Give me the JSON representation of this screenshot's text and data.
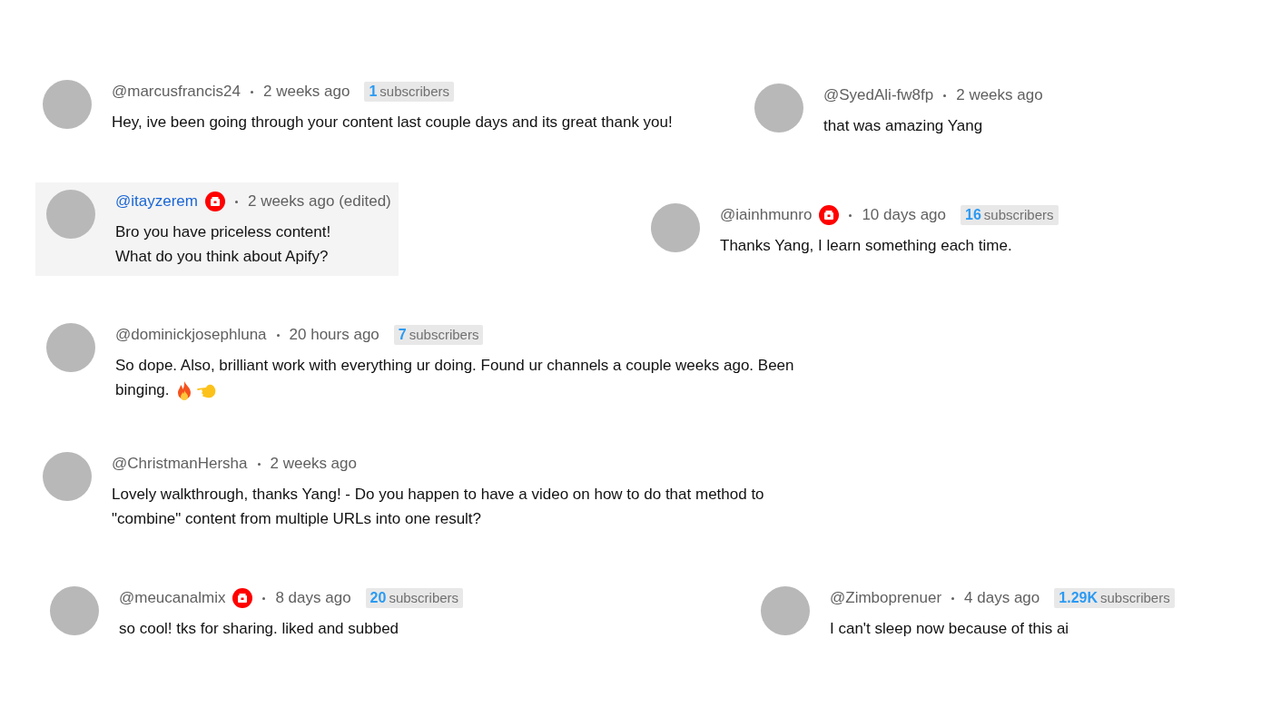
{
  "rows": [
    {
      "comments": [
        {
          "author": "@marcusfrancis24",
          "time": "2 weeks ago",
          "subscribers": {
            "count": "1",
            "label": "subscribers"
          },
          "highlighted": false,
          "lines": [
            "Hey, ive been going through your content last couple days and its great thank you!"
          ]
        },
        {
          "author": "@SyedAli-fw8fp",
          "time": "2 weeks ago",
          "highlighted": false,
          "lines": [
            "that was amazing Yang"
          ]
        }
      ]
    },
    {
      "comments": [
        {
          "author": "@itayzerem",
          "badge": true,
          "time": "2 weeks ago (edited)",
          "highlighted": true,
          "lines": [
            "Bro you have priceless content!",
            "What do you think about Apify?"
          ]
        },
        {
          "author": "@iainhmunro",
          "badge": true,
          "time": "10 days ago",
          "subscribers": {
            "count": "16",
            "label": "subscribers"
          },
          "highlighted": false,
          "lines": [
            "Thanks Yang, I learn something each time."
          ]
        }
      ]
    },
    {
      "comments": [
        {
          "author": "@dominickjosephluna",
          "time": "20 hours ago",
          "subscribers": {
            "count": "7",
            "label": "subscribers"
          },
          "highlighted": false,
          "lines": [
            "So dope. Also, brilliant work with everything ur doing. Found ur channels a couple weeks ago. Been",
            "binging."
          ],
          "emojis": true
        }
      ]
    },
    {
      "comments": [
        {
          "author": "@ChristmanHersha",
          "time": "2 weeks ago",
          "highlighted": false,
          "lines": [
            "Lovely walkthrough, thanks Yang! - Do you happen to have a video on how to do that method to",
            "\"combine\" content from multiple URLs into one result?"
          ]
        }
      ]
    },
    {
      "comments": [
        {
          "author": "@meucanalmix",
          "badge": true,
          "time": "8 days ago",
          "subscribers": {
            "count": "20",
            "label": "subscribers"
          },
          "highlighted": false,
          "lines": [
            "so cool! tks for sharing. liked and subbed"
          ]
        },
        {
          "author": "@Zimboprenuer",
          "time": "4 days ago",
          "subscribers": {
            "count": "1.29K",
            "label": "subscribers"
          },
          "highlighted": false,
          "lines": [
            "I can't sleep now because of this ai"
          ]
        }
      ]
    }
  ]
}
